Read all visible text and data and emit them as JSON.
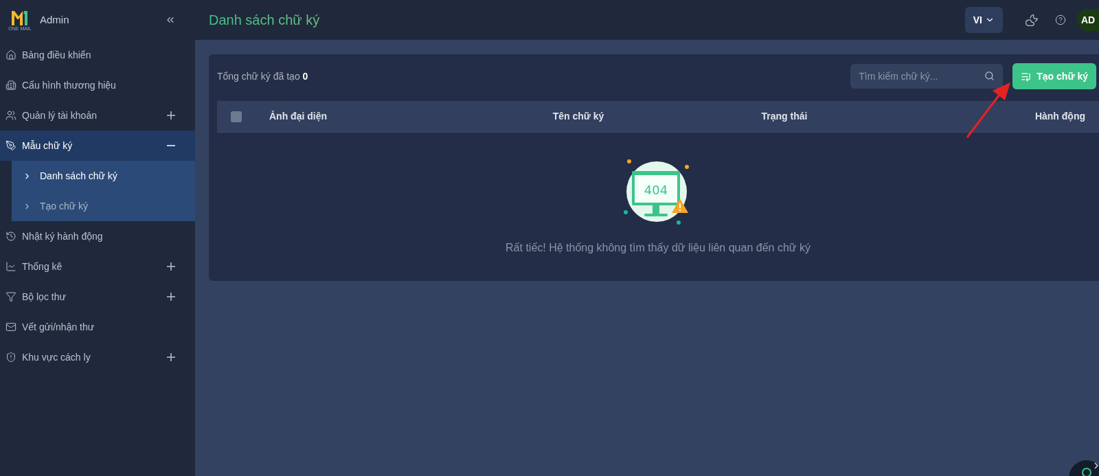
{
  "sidebar": {
    "logo_caption": "ONE MAIL",
    "title": "Admin",
    "items": [
      {
        "label": "Bảng điều khiển",
        "selected": false
      },
      {
        "label": "Cấu hình thương hiệu",
        "selected": false
      },
      {
        "label": "Quản lý tài khoản",
        "expanded": false,
        "selected": false
      },
      {
        "label": "Mẫu chữ ký",
        "expanded": true,
        "selected": true,
        "children": [
          {
            "label": "Danh sách chữ ký",
            "selected": true
          },
          {
            "label": "Tạo chữ ký",
            "selected": false
          }
        ]
      },
      {
        "label": "Nhật ký hành động",
        "selected": false
      },
      {
        "label": "Thống kê",
        "expanded": false,
        "selected": false
      },
      {
        "label": "Bộ lọc thư",
        "expanded": false,
        "selected": false
      },
      {
        "label": "Vết gửi/nhận thư",
        "selected": false
      },
      {
        "label": "Khu vực cách ly",
        "expanded": false,
        "selected": false
      }
    ]
  },
  "header": {
    "title": "Danh sách chữ ký",
    "language": "VI",
    "avatar": "AD"
  },
  "panel": {
    "total_label": "Tổng chữ ký đã tạo",
    "total_count": "0",
    "search": {
      "placeholder": "Tìm kiếm chữ ký..."
    },
    "create_button": "Tạo chữ ký",
    "table": {
      "select_all_checked": false,
      "columns": [
        "Ảnh đại diện",
        "Tên chữ ký",
        "Trạng thái",
        "Hành động"
      ]
    },
    "illustration_text": "404",
    "empty_message": "Rất tiếc! Hệ thống không tìm thấy dữ liệu liên quan đến chữ ký"
  }
}
